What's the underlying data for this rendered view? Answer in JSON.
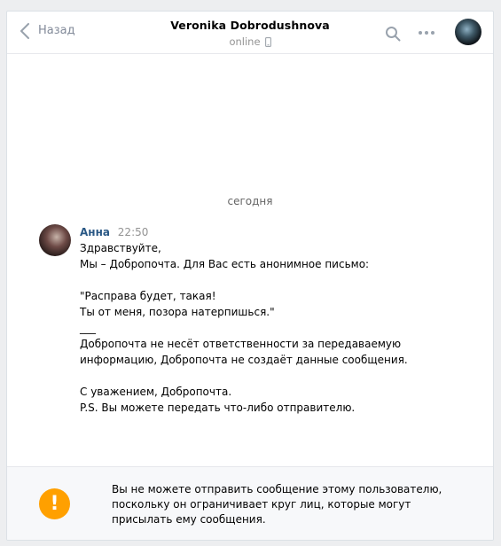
{
  "header": {
    "back_label": "Назад",
    "peer_name": "Veronika Dobrodushnova",
    "peer_status": "online"
  },
  "conversation": {
    "date_separator": "сегодня",
    "message": {
      "author": "Анна",
      "time": "22:50",
      "lines": [
        "Здравствуйте,",
        "Мы – Добропочта. Для Вас есть анонимное письмо:",
        "",
        "\"Расправа будет, такая!",
        "Ты от меня, позора натерпишься.\"",
        "___",
        "Добропочта не несёт ответственности за передаваемую",
        "информацию, Добропочта не создаёт данные сообщения.",
        "",
        "С уважением, Добропочта.",
        "P.S. Вы можете передать что-либо отправителю."
      ]
    }
  },
  "footer": {
    "warning_text": "Вы не можете отправить сообщение этому пользователю, поскольку он ограничивает круг лиц, которые могут присылать ему сообщения.",
    "warning_icon": "!"
  },
  "colors": {
    "author": "#2a5885",
    "muted": "#939393",
    "warning": "#ffa000",
    "page_bg": "#edeef0"
  }
}
